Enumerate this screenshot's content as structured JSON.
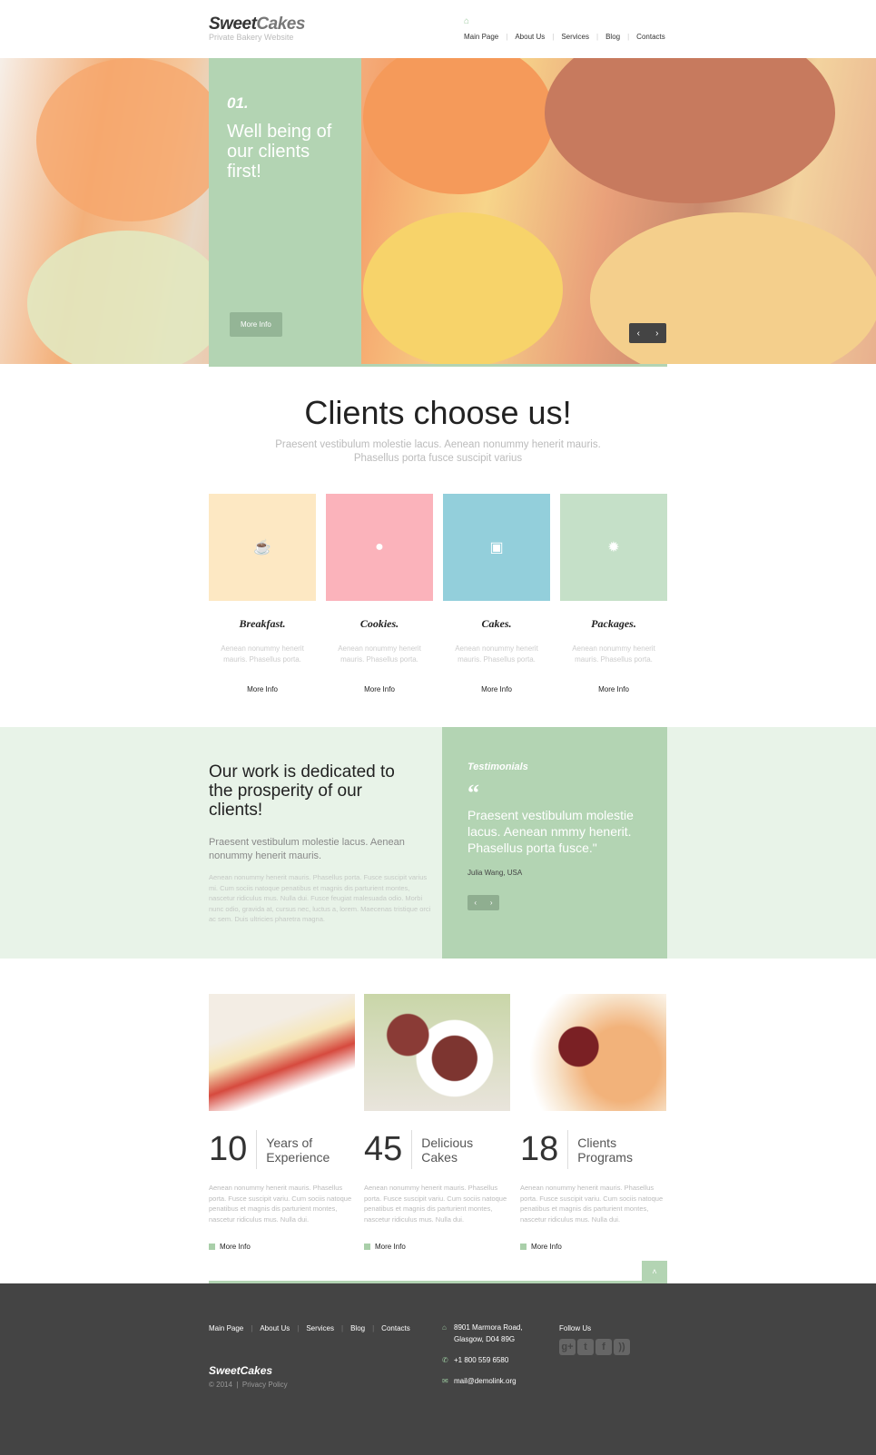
{
  "header": {
    "logo_a": "Sweet",
    "logo_b": "Cakes",
    "tagline": "Private Bakery Website",
    "nav": [
      "Main Page",
      "About Us",
      "Services",
      "Blog",
      "Contacts"
    ]
  },
  "hero": {
    "number": "01.",
    "title": "Well being of our clients first!",
    "button": "More Info"
  },
  "clients": {
    "title": "Clients choose us!",
    "subtitle_1": "Praesent vestibulum molestie lacus. Aenean nonummy henerit mauris.",
    "subtitle_2": "Phasellus porta fusce suscipit varius",
    "tiles": [
      {
        "title": "Breakfast.",
        "text": "Aenean nonummy henerit mauris. Phasellus porta.",
        "link": "More Info",
        "color": "#fde8c3",
        "icon": "coffee-cup-icon"
      },
      {
        "title": "Cookies.",
        "text": "Aenean nonummy henerit mauris. Phasellus porta.",
        "link": "More Info",
        "color": "#fbb3bb",
        "icon": "cookie-icon"
      },
      {
        "title": "Cakes.",
        "text": "Aenean nonummy henerit mauris. Phasellus porta.",
        "link": "More Info",
        "color": "#93cfdb",
        "icon": "cake-icon"
      },
      {
        "title": "Packages.",
        "text": "Aenean nonummy henerit mauris. Phasellus porta.",
        "link": "More Info",
        "color": "#c5e0c8",
        "icon": "gear-icon"
      }
    ]
  },
  "about": {
    "title": "Our work is dedicated to the prosperity of our clients!",
    "subtitle": "Praesent vestibulum molestie lacus. Aenean nonummy henerit mauris.",
    "text": "Aenean nonummy henerit mauris. Phasellus porta. Fusce suscipit varius mi. Cum sociis natoque penatibus et magnis dis parturient montes, nascetur ridiculus mus. Nulla dui. Fusce feugiat malesuada odio. Morbi nunc odio, gravida at, cursus nec, luctus a, lorem. Maecenas tristique orci ac sem. Duis ultricies pharetra magna."
  },
  "testimonials": {
    "heading": "Testimonials",
    "quote": "Praesent vestibulum molestie lacus. Aenean nmmy henerit. Phasellus porta fusce.\"",
    "author": "Julia Wang, USA"
  },
  "stats": [
    {
      "number": "10",
      "label": "Years of Experience",
      "text": "Aenean nonummy henerit mauris. Phasellus porta. Fusce suscipit variu. Cum sociis natoque penatibus et magnis dis parturient montes, nascetur ridiculus mus. Nulla dui.",
      "link": "More Info"
    },
    {
      "number": "45",
      "label": "Delicious Cakes",
      "text": "Aenean nonummy henerit mauris. Phasellus porta. Fusce suscipit variu. Cum sociis natoque penatibus et magnis dis parturient montes, nascetur ridiculus mus. Nulla dui.",
      "link": "More Info"
    },
    {
      "number": "18",
      "label": "Clients Programs",
      "text": "Aenean nonummy henerit mauris. Phasellus porta. Fusce suscipit variu. Cum sociis natoque penatibus et magnis dis parturient montes, nascetur ridiculus mus. Nulla dui.",
      "link": "More Info"
    }
  ],
  "footer": {
    "nav": [
      "Main Page",
      "About Us",
      "Services",
      "Blog",
      "Contacts"
    ],
    "logo": "SweetCakes",
    "copyright": "© 2014",
    "privacy": "Privacy Policy",
    "address_1": "8901 Marmora Road,",
    "address_2": "Glasgow, D04 89G",
    "phone": "+1 800 559 6580",
    "email": "mail@demolink.org",
    "follow": "Follow Us",
    "social": [
      "google-plus-icon",
      "twitter-icon",
      "facebook-icon",
      "rss-icon"
    ]
  },
  "colors": {
    "accent": "#b3d4b3",
    "footer": "#444444"
  }
}
